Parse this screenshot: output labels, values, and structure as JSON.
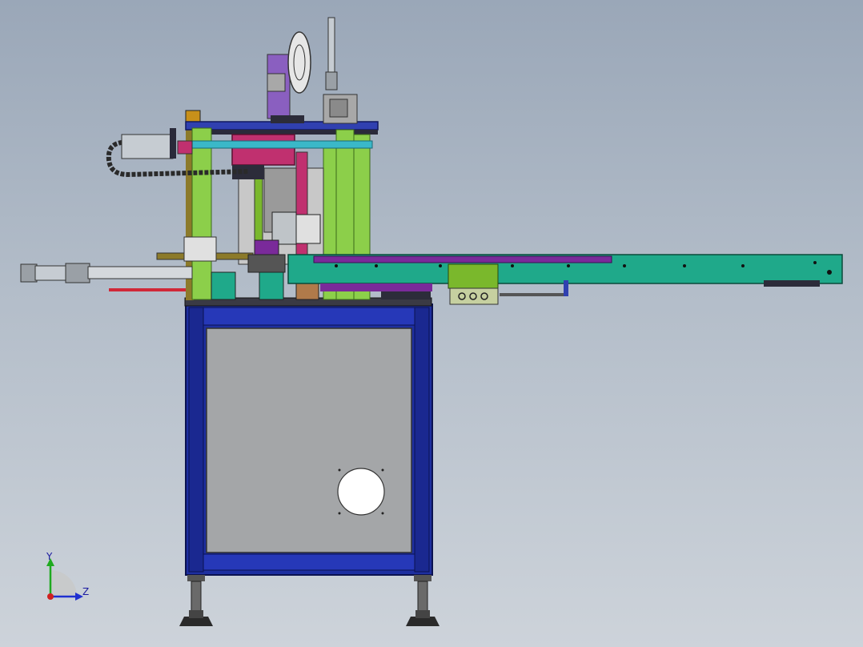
{
  "viewport": {
    "background_top": "#9aa7b8",
    "background_bottom": "#cdd3da"
  },
  "triad": {
    "y_label": "Y",
    "z_label": "Z",
    "y_color": "#1faa1f",
    "z_color": "#2030d0",
    "x_color": "#d02020"
  },
  "colors": {
    "frame_blue": "#1e2fa0",
    "panel_gray": "#a4a6a8",
    "column_green": "#8ccf4a",
    "conveyor_teal": "#1fa98a",
    "conveyor_purple": "#7a2a9a",
    "magenta": "#c0306f",
    "lavender": "#8a5fc0",
    "lime_block": "#7ab82c",
    "cyan_rod": "#3ab8c8",
    "cylinder_silver": "#c6ccd2",
    "dark_plate": "#2c2c3a"
  }
}
